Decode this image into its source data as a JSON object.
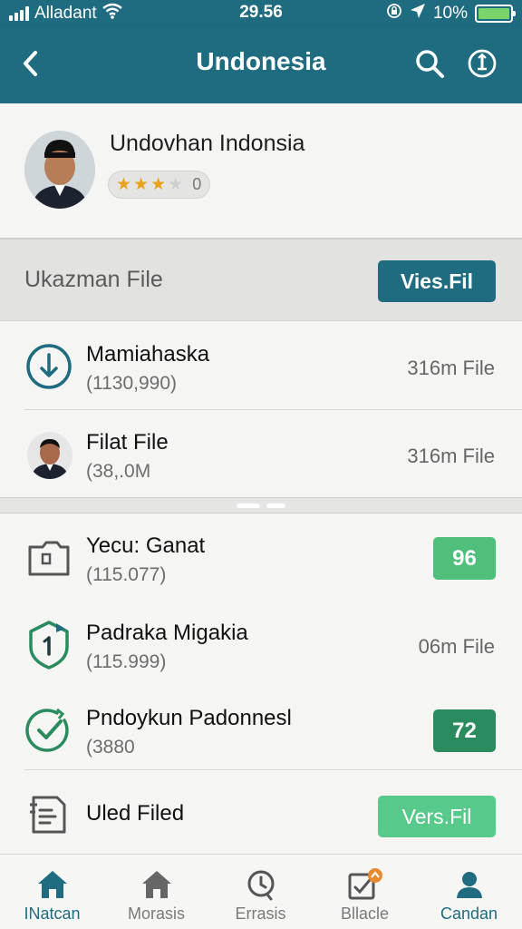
{
  "status_bar": {
    "carrier": "Alladant",
    "time": "29.56",
    "battery": "10%"
  },
  "header": {
    "title": "Undonesia",
    "back_icon": "chevron-left-icon",
    "search_icon": "search-icon",
    "action_icon": "info-icon"
  },
  "profile": {
    "name": "Undovhan Indonsia",
    "rating_stars": 3,
    "rating_max": 4,
    "rating_count": "0"
  },
  "section": {
    "title": "Ukazman File",
    "button_label": "Vies.Fil"
  },
  "files": [
    {
      "title": "Mamiahaska",
      "sub": "(1130,990)",
      "size": "316m File",
      "icon": "download-icon"
    },
    {
      "title": "Filat File",
      "sub": "(38,.0M",
      "size": "316m File",
      "icon": "avatar"
    }
  ],
  "items": [
    {
      "title": "Yecu: Ganat",
      "sub": "(115.077)",
      "badge": "96",
      "icon": "folder-icon"
    },
    {
      "title": "Padraka Migakia",
      "sub": "(115.999)",
      "size": "06m File",
      "icon": "shield-icon"
    },
    {
      "title": "Pndoykun Padonnesl",
      "sub": "(3880",
      "badge": "72",
      "icon": "check-circle-icon"
    },
    {
      "title": "Uled Filed",
      "button_label": "Vers.Fil",
      "icon": "document-icon"
    }
  ],
  "nav": [
    {
      "label": "INatcan",
      "icon": "home-icon"
    },
    {
      "label": "Morasis",
      "icon": "home-icon"
    },
    {
      "label": "Errasis",
      "icon": "clock-icon"
    },
    {
      "label": "Bllacle",
      "icon": "edit-box-icon"
    },
    {
      "label": "Candan",
      "icon": "user-icon"
    }
  ],
  "colors": {
    "primary": "#1f6b80",
    "badge_light": "#4fbf7b",
    "badge_dark": "#2a8c5e",
    "button_green": "#57c98a",
    "star": "#e9a21e"
  }
}
